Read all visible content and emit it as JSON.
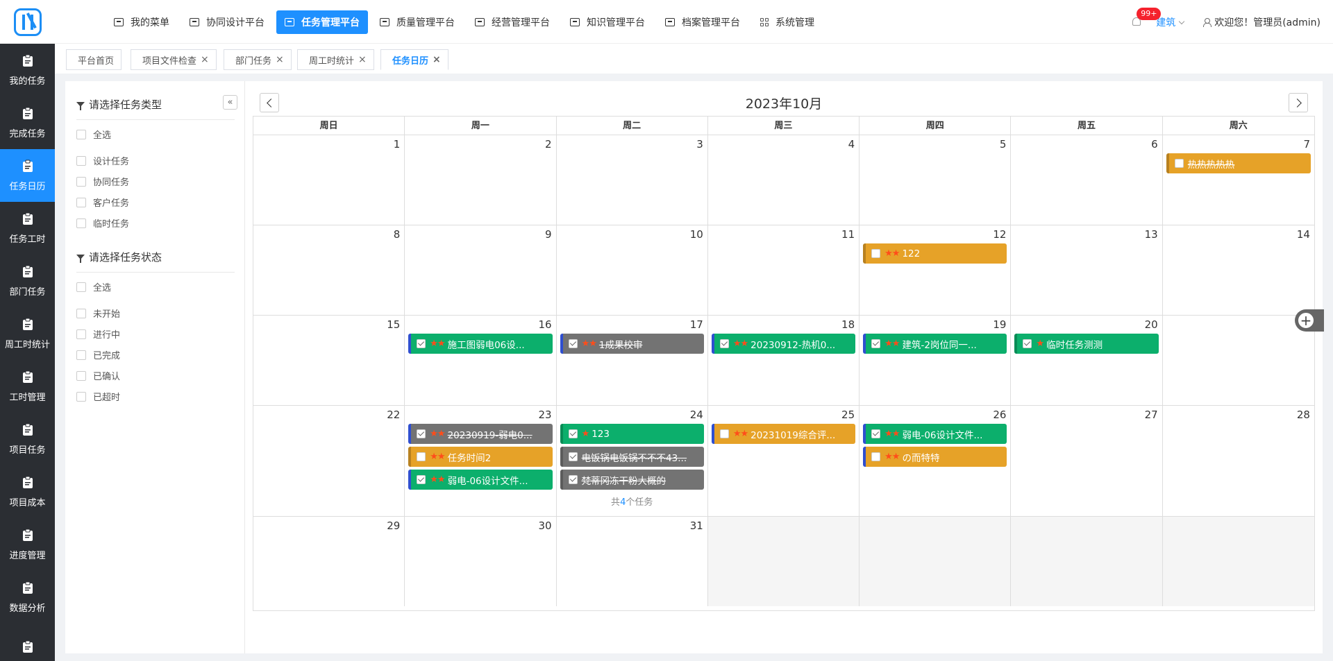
{
  "sidebar": {
    "items": [
      {
        "label": "我的任务",
        "icon": "clipboard-icon"
      },
      {
        "label": "完成任务",
        "icon": "document-icon"
      },
      {
        "label": "任务日历",
        "icon": "calendar-icon"
      },
      {
        "label": "任务工时",
        "icon": "timer-icon"
      },
      {
        "label": "部门任务",
        "icon": "building-icon"
      },
      {
        "label": "周工时统计",
        "icon": "calendar-7-icon"
      },
      {
        "label": "工时管理",
        "icon": "clipboard-check-icon"
      },
      {
        "label": "项目任务",
        "icon": "folder-icon"
      },
      {
        "label": "项目成本",
        "icon": "money-bag-icon"
      },
      {
        "label": "进度管理",
        "icon": "server-icon"
      },
      {
        "label": "数据分析",
        "icon": "pie-chart-icon"
      },
      {
        "label": "",
        "icon": "document-icon"
      }
    ]
  },
  "topnav": {
    "items": [
      "我的菜单",
      "协同设计平台",
      "任务管理平台",
      "质量管理平台",
      "经营管理平台",
      "知识管理平台",
      "档案管理平台",
      "系统管理"
    ]
  },
  "header": {
    "badge": "99+",
    "org": "建筑",
    "welcome": "欢迎您！管理员(admin)"
  },
  "tabs": [
    "平台首页",
    "项目文件检查",
    "部门任务",
    "周工时统计",
    "任务日历"
  ],
  "filter": {
    "type_title": "请选择任务类型",
    "type_all": "全选",
    "types": [
      "设计任务",
      "协同任务",
      "客户任务",
      "临时任务"
    ],
    "status_title": "请选择任务状态",
    "status_all": "全选",
    "statuses": [
      "未开始",
      "进行中",
      "已完成",
      "已确认",
      "已超时"
    ],
    "collapse": "«"
  },
  "calendar": {
    "title": "2023年10月",
    "weekdays": [
      "周日",
      "周一",
      "周二",
      "周三",
      "周四",
      "周五",
      "周六"
    ],
    "weeks": [
      [
        "1",
        "2",
        "3",
        "4",
        "5",
        "6",
        "7"
      ],
      [
        "8",
        "9",
        "10",
        "11",
        "12",
        "13",
        "14"
      ],
      [
        "15",
        "16",
        "17",
        "18",
        "19",
        "20",
        ""
      ],
      [
        "22",
        "23",
        "24",
        "25",
        "26",
        "27",
        "28"
      ],
      [
        "29",
        "30",
        "31",
        "",
        "",
        "",
        ""
      ]
    ],
    "events": [
      {
        "week": 0,
        "day": 6,
        "slot": 0,
        "text": "热热热热热",
        "stars": "",
        "color": "orange",
        "border": "",
        "checked": false,
        "strike": true
      },
      {
        "week": 1,
        "day": 4,
        "slot": 0,
        "text": "122",
        "stars": "★★",
        "color": "orange",
        "border": "",
        "checked": false,
        "strike": false
      },
      {
        "week": 2,
        "day": 1,
        "slot": 0,
        "text": "施工图弱电06设...",
        "stars": "★★",
        "color": "green",
        "border": "bl-blue",
        "checked": true,
        "strike": false
      },
      {
        "week": 2,
        "day": 2,
        "slot": 0,
        "text": "1成果校审",
        "stars": "★★",
        "color": "gray",
        "border": "bl-blue",
        "checked": true,
        "strike": true
      },
      {
        "week": 2,
        "day": 3,
        "slot": 0,
        "text": "20230912-热机0...",
        "stars": "★★",
        "color": "green",
        "border": "bl-blue",
        "checked": true,
        "strike": false
      },
      {
        "week": 2,
        "day": 4,
        "slot": 0,
        "text": "建筑-2岗位同一...",
        "stars": "★★",
        "color": "green",
        "border": "bl-blue",
        "checked": true,
        "strike": false
      },
      {
        "week": 2,
        "day": 5,
        "slot": 0,
        "text": "临时任务测测",
        "stars": "★",
        "color": "green",
        "border": "",
        "checked": true,
        "strike": false
      },
      {
        "week": 3,
        "day": 1,
        "slot": 0,
        "text": "20230919-弱电0...",
        "stars": "★★",
        "color": "gray",
        "border": "bl-blue",
        "checked": true,
        "strike": true
      },
      {
        "week": 3,
        "day": 1,
        "slot": 1,
        "text": "任务时间2",
        "stars": "★★",
        "color": "orange",
        "border": "",
        "checked": false,
        "strike": false
      },
      {
        "week": 3,
        "day": 1,
        "slot": 2,
        "text": "弱电-06设计文件...",
        "stars": "★★",
        "color": "green",
        "border": "bl-blue",
        "checked": true,
        "strike": false
      },
      {
        "week": 3,
        "day": 2,
        "slot": 0,
        "text": "123",
        "stars": "★",
        "color": "green",
        "border": "",
        "checked": true,
        "strike": false
      },
      {
        "week": 3,
        "day": 2,
        "slot": 1,
        "text": "电饭锅电饭锅不不不43...",
        "stars": "",
        "color": "gray",
        "border": "",
        "checked": true,
        "strike": true
      },
      {
        "week": 3,
        "day": 2,
        "slot": 2,
        "text": "梵蒂冈冻干粉大概的",
        "stars": "",
        "color": "gray",
        "border": "",
        "checked": true,
        "strike": true
      },
      {
        "week": 3,
        "day": 3,
        "slot": 0,
        "text": "20231019综合评...",
        "stars": "★★",
        "color": "orange",
        "border": "bl-blue",
        "checked": false,
        "strike": false
      },
      {
        "week": 3,
        "day": 4,
        "slot": 0,
        "text": "弱电-06设计文件...",
        "stars": "★★",
        "color": "green",
        "border": "bl-blue",
        "checked": true,
        "strike": false
      },
      {
        "week": 3,
        "day": 4,
        "slot": 1,
        "text": "の而特特",
        "stars": "★★",
        "color": "orange",
        "border": "bl-blue",
        "checked": false,
        "strike": false
      }
    ],
    "more": {
      "week": 3,
      "day": 2,
      "prefix": "共",
      "count": "4",
      "suffix": "个任务"
    }
  },
  "colors": {
    "accent": "#1e90ff",
    "green": "#0caf6c",
    "gray": "#737373",
    "orange": "#e6a228",
    "sidebar": "#2b2e33"
  }
}
